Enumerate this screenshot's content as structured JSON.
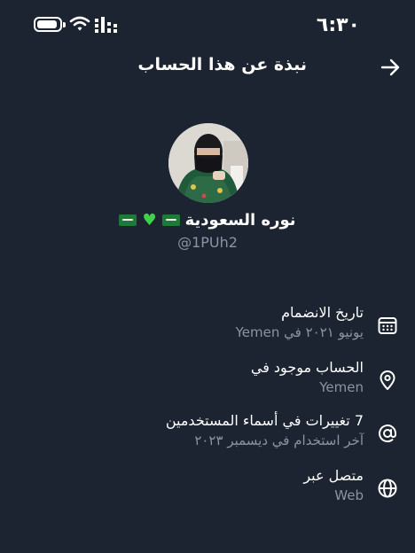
{
  "status_bar": {
    "time": "٦:٣٠",
    "icons": [
      "battery-icon",
      "wifi-icon",
      "cellular-signal-icon"
    ]
  },
  "header": {
    "title": "نبذة عن هذا الحساب",
    "back_icon": "arrow-icon"
  },
  "profile": {
    "display_name": "نوره السعودية",
    "decorations": [
      "saudi-flag",
      "green-heart",
      "saudi-flag"
    ],
    "username": "@1PUh2"
  },
  "info": [
    {
      "icon": "calendar-icon",
      "title": "تاريخ الانضمام",
      "subtitle": "يونيو ٢٠٢١ في Yemen"
    },
    {
      "icon": "location-pin-icon",
      "title": "الحساب موجود في",
      "subtitle": "Yemen"
    },
    {
      "icon": "at-sign-icon",
      "title": "7 تغييرات في أسماء المستخدمين",
      "subtitle": "آخر استخدام في ديسمبر ٢٠٢٣"
    },
    {
      "icon": "globe-icon",
      "title": "متصل عبر",
      "subtitle": "Web"
    }
  ],
  "colors": {
    "background": "#1c2431",
    "primary_text": "#ffffff",
    "secondary_text": "#8a94a3",
    "heart": "#3ed24a",
    "flag": "#1f7a3a"
  }
}
